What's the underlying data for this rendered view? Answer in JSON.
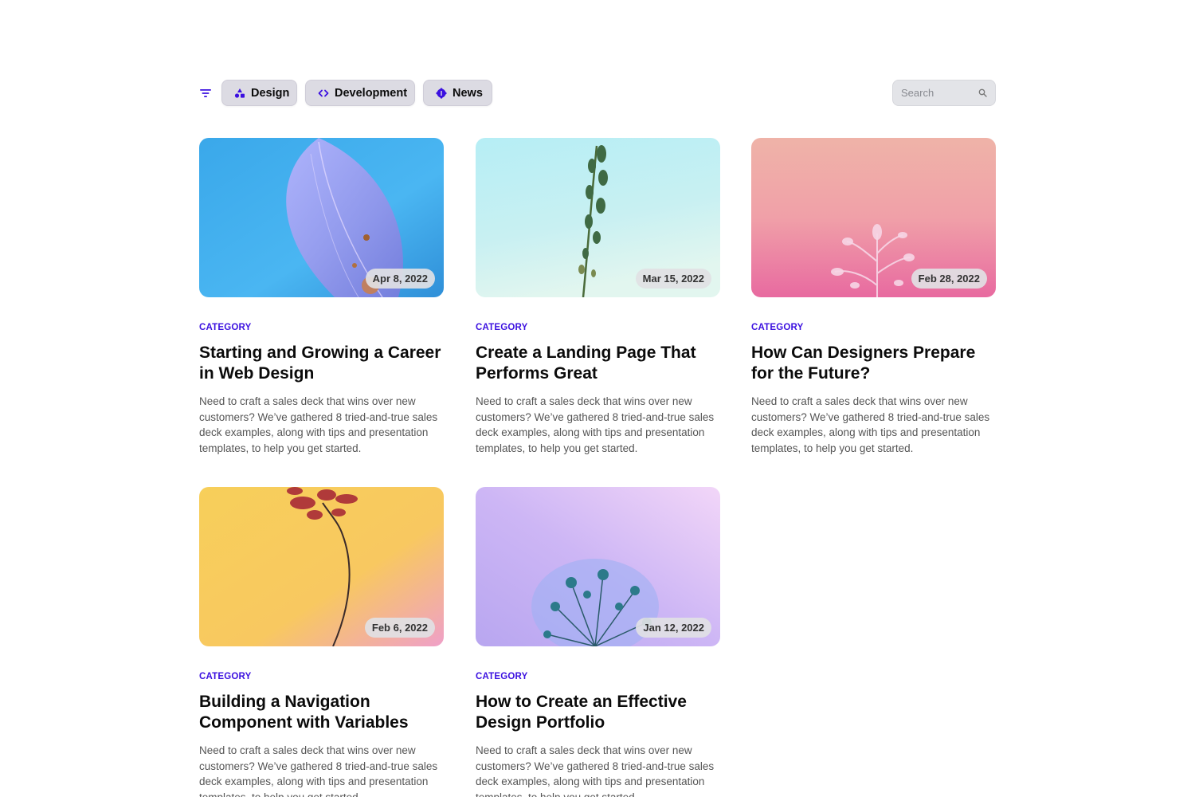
{
  "filters": {
    "chips": [
      {
        "label": "Design",
        "icon": "shapes-icon"
      },
      {
        "label": "Development",
        "icon": "code-icon"
      },
      {
        "label": "News",
        "icon": "badge-icon"
      }
    ],
    "search": {
      "placeholder": "Search"
    }
  },
  "colors": {
    "accent": "#3b10e0",
    "chip_bg": "#dcdbe3"
  },
  "posts": [
    {
      "date": "Apr 8, 2022",
      "category": "CATEGORY",
      "title": "Starting and Growing a Career in Web Design",
      "description": "Need to craft a sales deck that wins over new customers? We’ve gathered 8 tried-and-true sales deck examples, along with tips and presentation templates, to help you get started."
    },
    {
      "date": "Mar 15, 2022",
      "category": "CATEGORY",
      "title": "Create a Landing Page That Performs Great",
      "description": "Need to craft a sales deck that wins over new customers? We’ve gathered 8 tried-and-true sales deck examples, along with tips and presentation templates, to help you get started."
    },
    {
      "date": "Feb 28, 2022",
      "category": "CATEGORY",
      "title": "How Can Designers Prepare for the Future?",
      "description": "Need to craft a sales deck that wins over new customers? We’ve gathered 8 tried-and-true sales deck examples, along with tips and presentation templates, to help you get started."
    },
    {
      "date": "Feb 6, 2022",
      "category": "CATEGORY",
      "title": "Building a Navigation Component with Variables",
      "description": "Need to craft a sales deck that wins over new customers? We’ve gathered 8 tried-and-true sales deck examples, along with tips and presentation templates, to help you get started."
    },
    {
      "date": "Jan 12, 2022",
      "category": "CATEGORY",
      "title": "How to Create an Effective Design Portfolio",
      "description": "Need to craft a sales deck that wins over new customers? We’ve gathered 8 tried-and-true sales deck examples, along with tips and presentation templates, to help you get started."
    }
  ]
}
